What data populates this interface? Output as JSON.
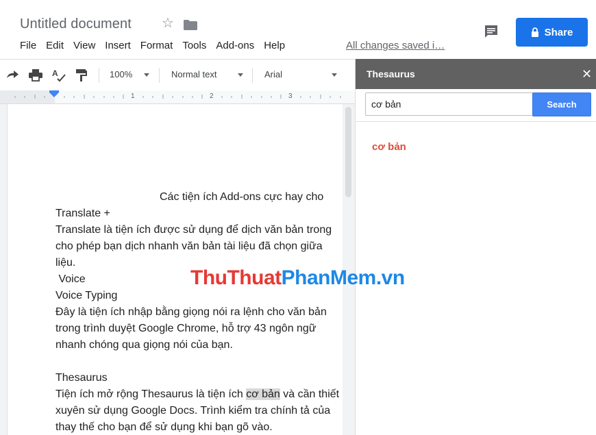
{
  "header": {
    "doc_title": "Untitled document",
    "star_icon": "star-outline-icon",
    "folder_icon": "folder-icon",
    "menu": [
      "File",
      "Edit",
      "View",
      "Insert",
      "Format",
      "Tools",
      "Add-ons",
      "Help"
    ],
    "saved_status": "All changes saved i…",
    "comment_icon": "comment-icon",
    "share_label": "Share",
    "share_icon": "lock-icon",
    "share_color": "#1a73e8"
  },
  "toolbar": {
    "zoom": "100%",
    "style": "Normal text",
    "font": "Arial"
  },
  "ruler": {
    "numbers": [
      "1",
      "2",
      "3"
    ]
  },
  "document": {
    "lines": [
      "Các tiện ích Add-ons cực hay cho",
      "Translate +",
      "Translate là tiện ích được sử dụng để dịch văn bản trong",
      "cho phép bạn dịch nhanh văn bản tài liệu đã chọn giữa",
      "liệu.",
      " Voice",
      "Voice Typing",
      "Đây là tiện ích nhập bằng giọng nói ra lệnh cho văn bản",
      "trong trình duyệt Google Chrome, hỗ trợ 43 ngôn ngữ",
      "nhanh chóng qua giọng nói của bạn.",
      "Thesaurus",
      "xuyên sử dụng Google Docs. Trình kiểm tra chính tả của",
      "thay thế cho bạn để sử dụng khi bạn gõ vào."
    ],
    "thesaurus_line": {
      "before": "Tiện ích mở rộng Thesaurus là tiện ích ",
      "highlight": "cơ bản",
      "after": " và cần thiết"
    }
  },
  "thesaurus_panel": {
    "title": "Thesaurus",
    "close_icon": "close-icon",
    "search_value": "cơ bản",
    "search_button": "Search",
    "result_word": "cơ bản",
    "result_color": "#dd4b39"
  },
  "watermark": {
    "part1": "ThuThuat",
    "part2": "PhanMem.vn"
  }
}
